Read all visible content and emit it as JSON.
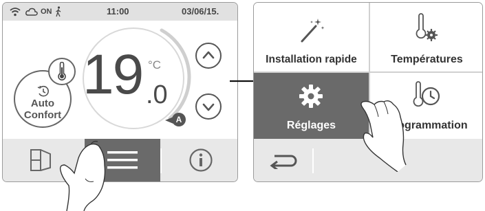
{
  "left_screen": {
    "status": {
      "on_label": "ON",
      "time": "11:00",
      "date": "03/06/15.",
      "icons": [
        "wifi-icon",
        "cloud-icon",
        "person-walking-icon"
      ]
    },
    "temperature": {
      "integer": "19",
      "decimal": ".0",
      "unit": "°C",
      "arc_marker": "A"
    },
    "mode": {
      "line1": "Auto",
      "line2": "Confort",
      "icon": "clock-icon"
    },
    "controls": {
      "up_icon": "chevron-up-icon",
      "down_icon": "chevron-down-icon"
    },
    "bottom_nav": [
      {
        "icon": "window-door-icon",
        "active": false
      },
      {
        "icon": "menu-icon",
        "active": true
      },
      {
        "icon": "info-icon",
        "active": false
      }
    ]
  },
  "right_screen": {
    "tiles": [
      {
        "label": "Installation rapide",
        "icon": "magic-wand-icon",
        "active": false
      },
      {
        "label": "Températures",
        "icon": "thermometer-gear-icon",
        "active": false
      },
      {
        "label": "Réglages",
        "icon": "gear-icon",
        "active": true
      },
      {
        "label": "Programmation",
        "icon": "thermometer-clock-icon",
        "active": false
      }
    ],
    "back_icon": "back-arrow-icon"
  },
  "colors": {
    "active_tile": "#6a6a6a",
    "bar_bg": "#e1e1e1",
    "accent_dark": "#555555"
  }
}
